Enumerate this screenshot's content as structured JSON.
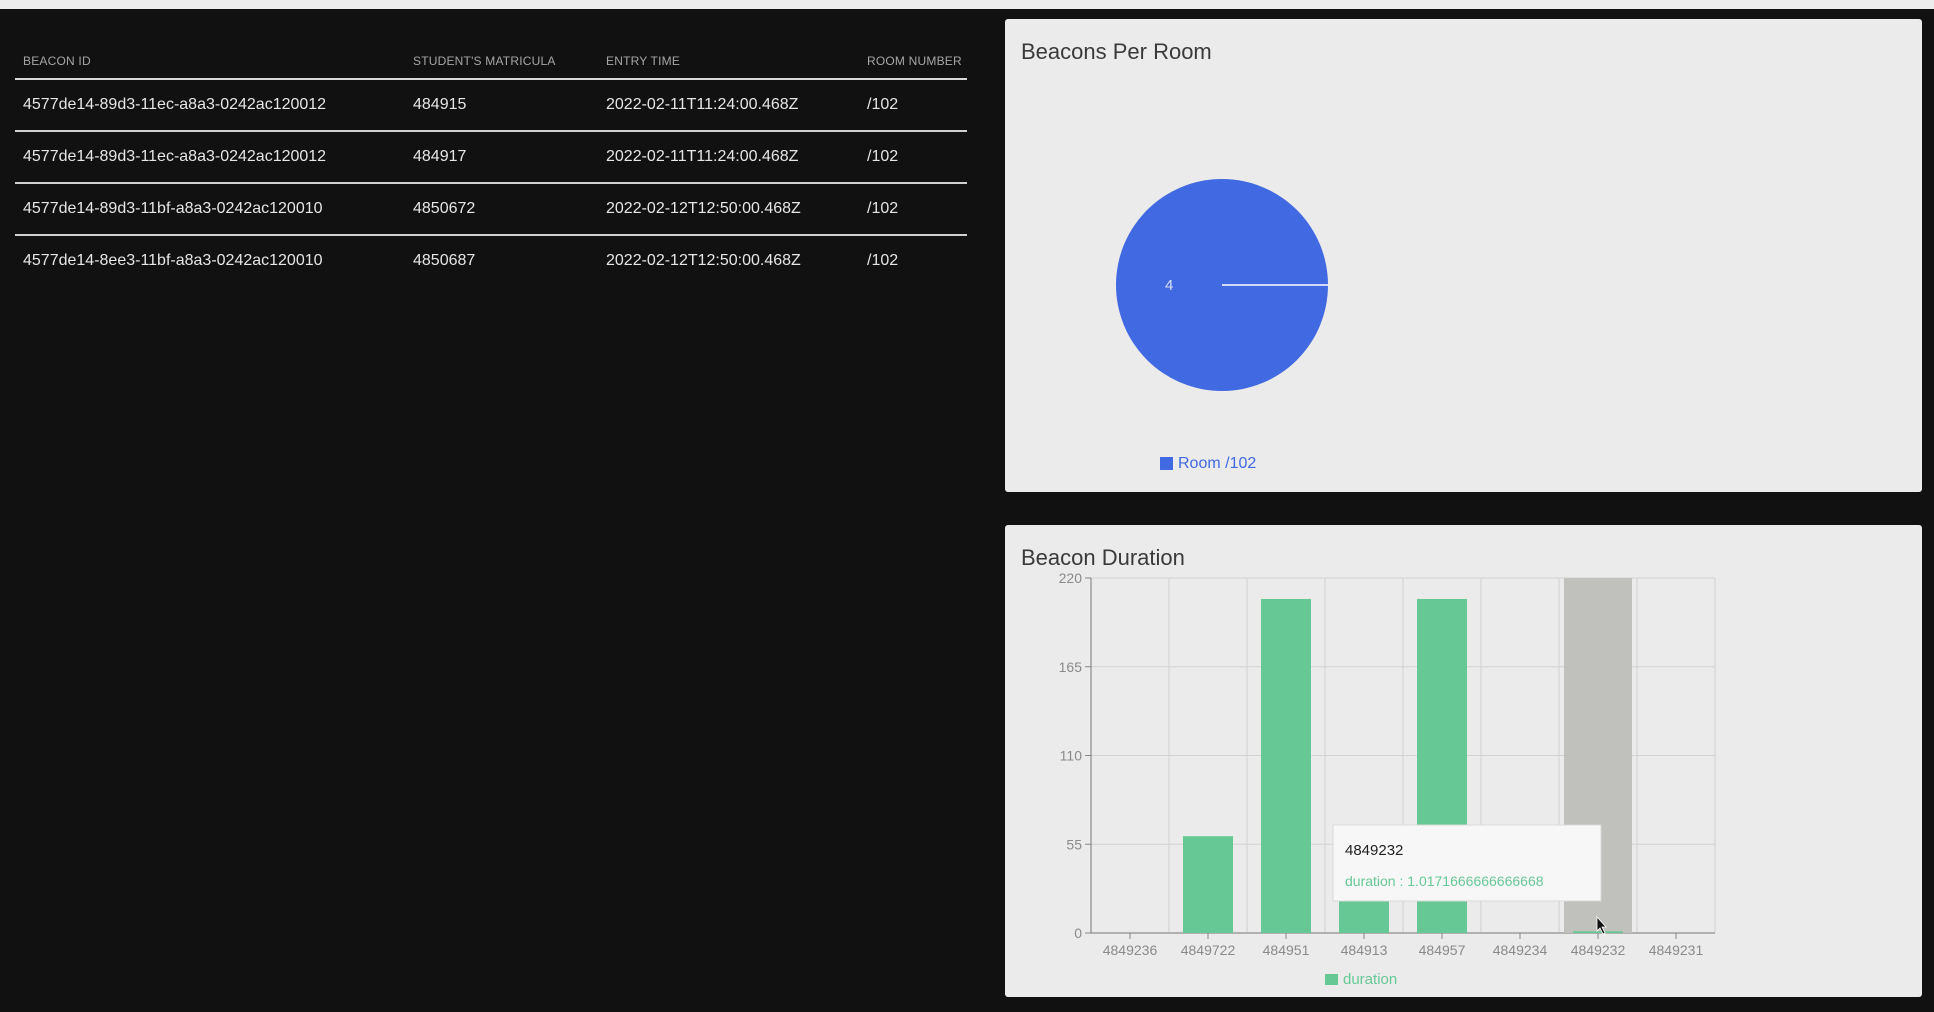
{
  "table": {
    "headers": [
      "BEACON ID",
      "STUDENT'S MATRICULA",
      "ENTRY TIME",
      "ROOM NUMBER"
    ],
    "rows": [
      [
        "4577de14-89d3-11ec-a8a3-0242ac120012",
        "484915",
        "2022-02-11T11:24:00.468Z",
        "/102"
      ],
      [
        "4577de14-89d3-11ec-a8a3-0242ac120012",
        "484917",
        "2022-02-11T11:24:00.468Z",
        "/102"
      ],
      [
        "4577de14-89d3-11bf-a8a3-0242ac120010",
        "4850672",
        "2022-02-12T12:50:00.468Z",
        "/102"
      ],
      [
        "4577de14-8ee3-11bf-a8a3-0242ac120010",
        "4850687",
        "2022-02-12T12:50:00.468Z",
        "/102"
      ]
    ]
  },
  "pie_card": {
    "title": "Beacons Per Room"
  },
  "bar_card": {
    "title": "Beacon Duration"
  },
  "tooltip": {
    "title": "4849232",
    "text": "duration : 1.0171666666666668"
  },
  "colors": {
    "pie": "#4169e1",
    "bar": "#66c995",
    "bar_active": "#c0c0bc",
    "tooltip_text": "#66c995"
  },
  "chart_data": [
    {
      "type": "pie",
      "title": "Beacons Per Room",
      "slices": [
        {
          "name": "Room /102",
          "value": 4,
          "label": "4"
        }
      ],
      "legend": "bottom-left"
    },
    {
      "type": "bar",
      "title": "Beacon Duration",
      "categories": [
        "4849236",
        "4849722",
        "484951",
        "484913",
        "484957",
        "4849234",
        "4849232",
        "4849231"
      ],
      "series": [
        {
          "name": "duration",
          "values": [
            0,
            60,
            207,
            20,
            207,
            0,
            1.0171666666666668,
            0
          ]
        }
      ],
      "ylim": [
        0,
        220
      ],
      "yticks": [
        0,
        55,
        110,
        165,
        220
      ],
      "grid": true,
      "legend": "bottom-center",
      "highlighted_category": "4849232"
    }
  ]
}
